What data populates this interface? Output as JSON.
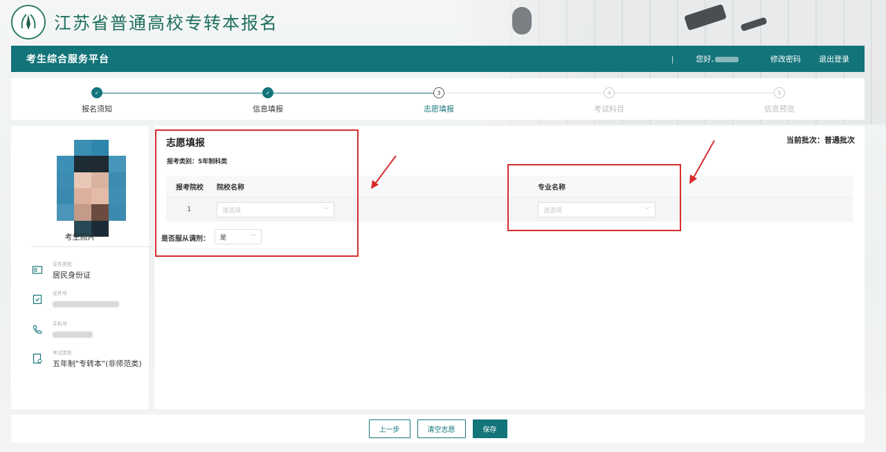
{
  "header": {
    "site_title": "江苏省普通高校专转本报名"
  },
  "navbar": {
    "title": "考生综合服务平台",
    "separator": "|",
    "greeting": "您好,",
    "change_password": "修改密码",
    "logout": "退出登录"
  },
  "steps": [
    {
      "label": "报名须知",
      "status": "done",
      "marker": "✓"
    },
    {
      "label": "信息填报",
      "status": "done",
      "marker": "✓"
    },
    {
      "label": "志愿填报",
      "status": "current",
      "marker": "3"
    },
    {
      "label": "考试科目",
      "status": "todo",
      "marker": "4"
    },
    {
      "label": "信息预览",
      "status": "todo",
      "marker": "5"
    }
  ],
  "sidebar": {
    "photo_caption": "考生照片",
    "items": [
      {
        "icon": "id-card-icon",
        "small_label": "证件类型",
        "value": "居民身份证"
      },
      {
        "icon": "clipboard-icon",
        "small_label": "证件号",
        "value": ""
      },
      {
        "icon": "phone-icon",
        "small_label": "手机号",
        "value": ""
      },
      {
        "icon": "exam-type-icon",
        "small_label": "考试类型",
        "value": "五年制\"专转本\"(非师范类)"
      }
    ]
  },
  "main": {
    "title": "志愿填报",
    "batch_label": "当前批次：普通批次",
    "category": "报考类别：5年制科类",
    "columns": {
      "school_order": "报考院校",
      "school_name": "院校名称",
      "major_name": "专业名称"
    },
    "rows": [
      {
        "order": "1",
        "school_placeholder": "请选择",
        "major_placeholder": "请选择"
      }
    ],
    "adjust_label": "是否服从调剂：",
    "adjust_value": "是"
  },
  "buttons": {
    "prev": "上一步",
    "clear": "清空志愿",
    "save": "保存"
  },
  "colors": {
    "primary": "#13747a",
    "annotation_red": "#d62b2b"
  }
}
